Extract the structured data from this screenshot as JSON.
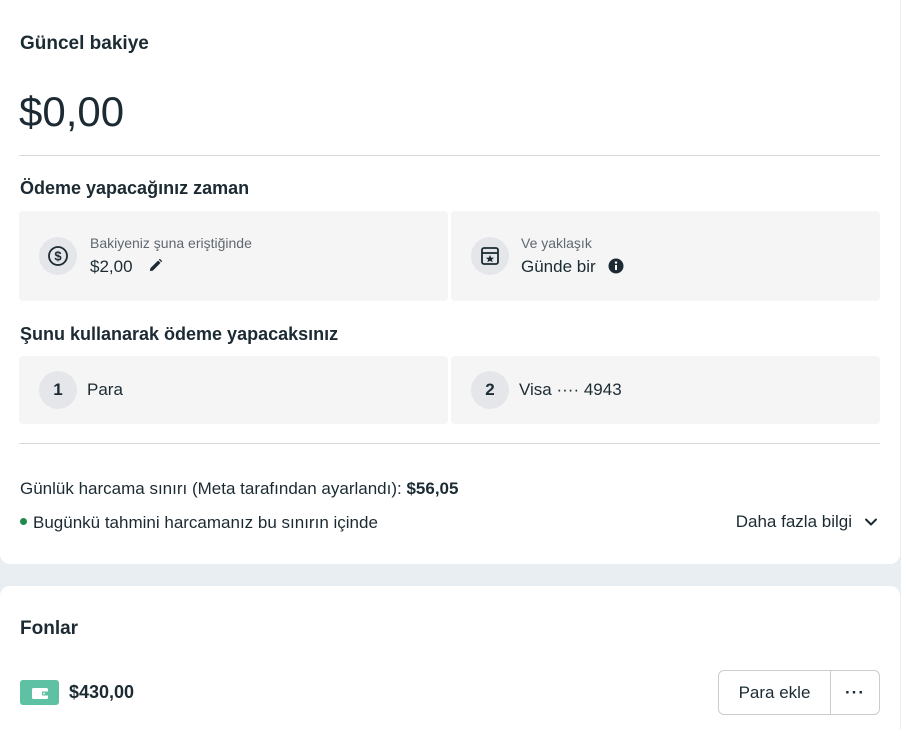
{
  "balance": {
    "title": "Güncel bakiye",
    "amount": "$0,00"
  },
  "payment_timing": {
    "title": "Ödeme yapacağınız zaman",
    "threshold_label": "Bakiyeniz şuna eriştiğinde",
    "threshold_value": "$2,00",
    "frequency_label": "Ve yaklaşık",
    "frequency_value": "Günde bir"
  },
  "payment_methods": {
    "title": "Şunu kullanarak ödeme yapacaksınız",
    "items": [
      {
        "order": "1",
        "label": "Para"
      },
      {
        "order": "2",
        "label": "Visa ···· 4943"
      }
    ]
  },
  "spending_limit": {
    "label": "Günlük harcama sınırı (Meta tarafından ayarlandı): ",
    "value": "$56,05",
    "status": "Bugünkü tahmini harcamanız bu sınırın içinde",
    "more_info": "Daha fazla bilgi",
    "status_color": "#1f8a4c"
  },
  "funds": {
    "title": "Fonlar",
    "amount": "$430,00",
    "add_button": "Para ekle",
    "more_button": "···",
    "wallet_color": "#5ec1a3"
  },
  "icons": {
    "threshold": "dollar-coin-icon",
    "frequency": "calendar-star-icon",
    "edit": "pencil-icon",
    "info": "info-icon",
    "expand": "chevron-down-icon",
    "wallet": "wallet-icon"
  }
}
